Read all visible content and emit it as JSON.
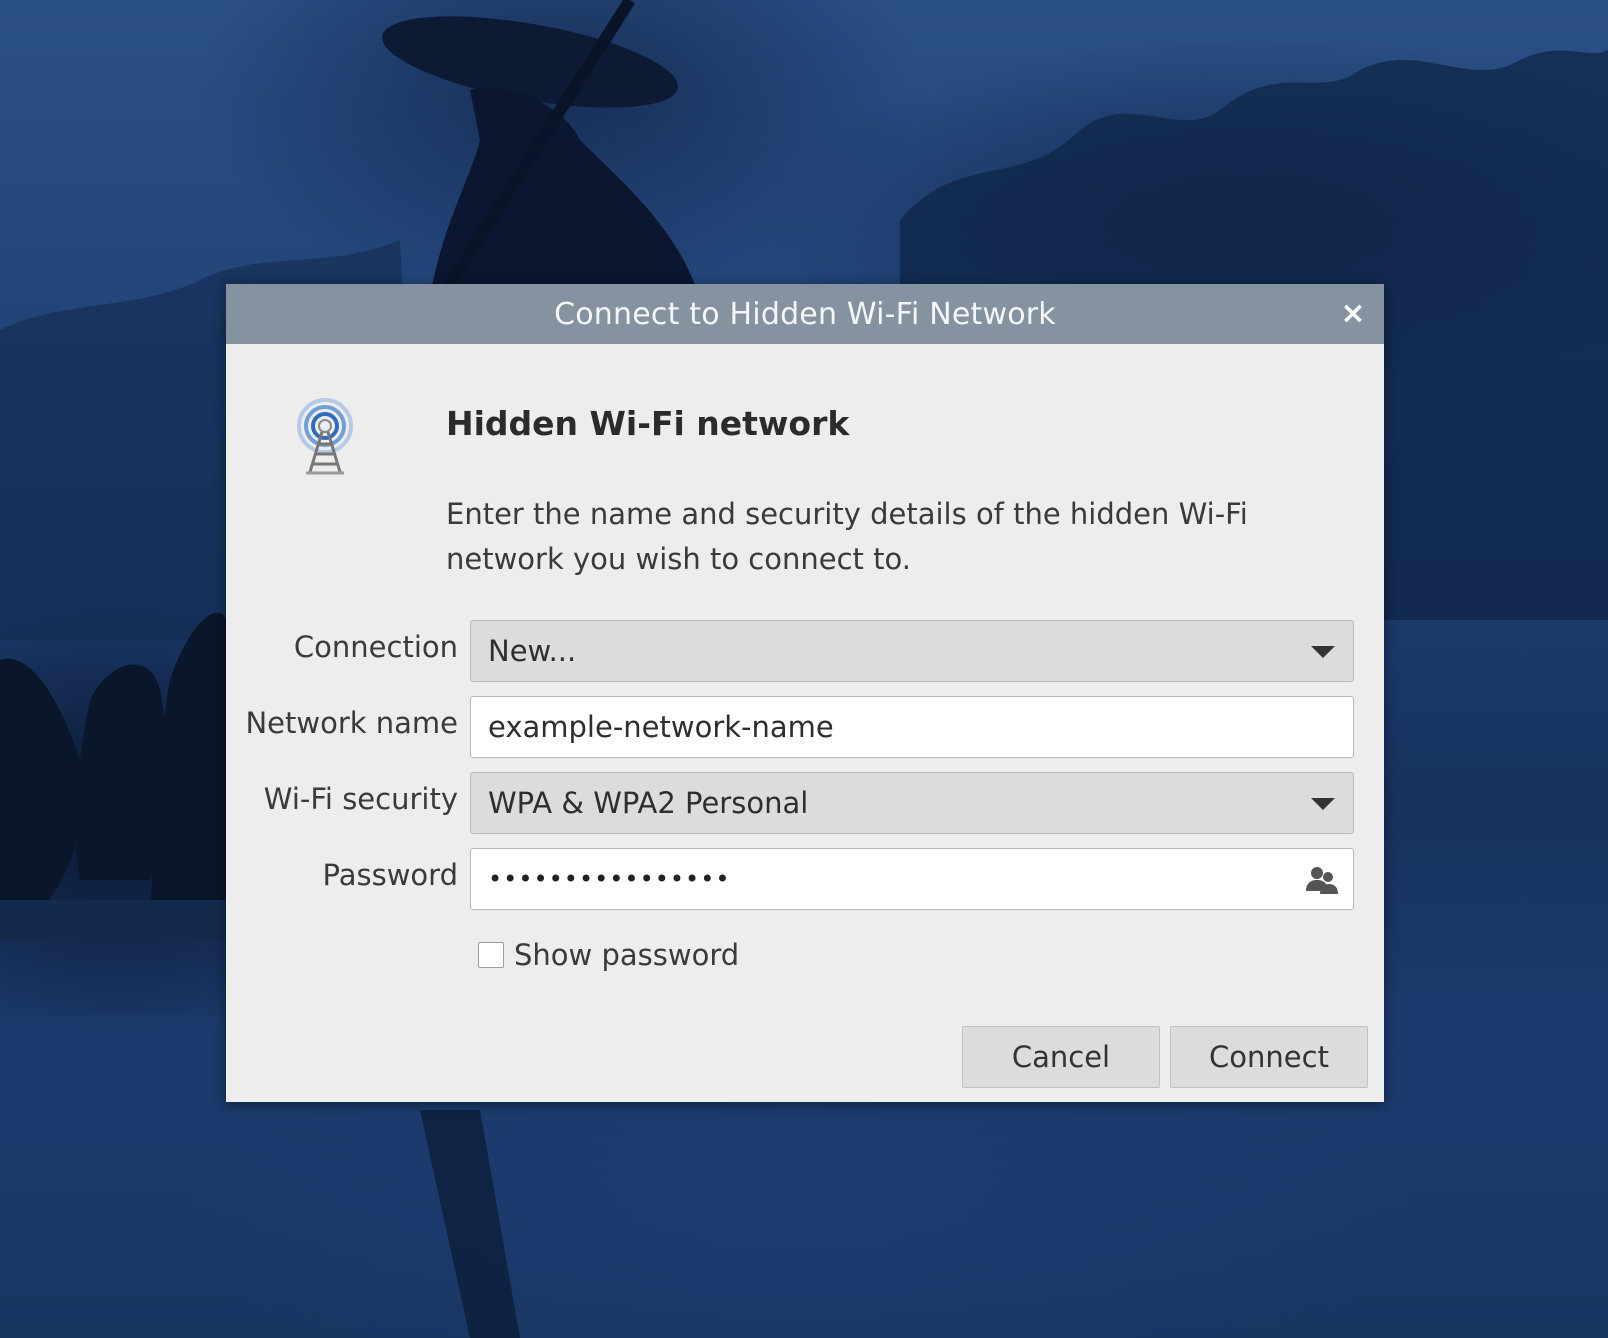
{
  "dialog": {
    "title": "Connect to Hidden Wi-Fi Network",
    "close_symbol": "×",
    "icon": "wifi-antenna-icon",
    "heading": "Hidden Wi-Fi network",
    "description": "Enter the name and security details of the hidden Wi-Fi network you wish to connect to.",
    "form": {
      "connection": {
        "label": "Connection",
        "value": "New..."
      },
      "network_name": {
        "label": "Network name",
        "value": "example-network-name"
      },
      "wifi_security": {
        "label": "Wi-Fi security",
        "value": "WPA & WPA2 Personal"
      },
      "password": {
        "label": "Password",
        "value": "••••••••••••••••",
        "icon": "user-options-icon"
      },
      "show_password": {
        "label": "Show password",
        "checked": false
      }
    },
    "buttons": {
      "cancel": "Cancel",
      "connect": "Connect"
    }
  },
  "colors": {
    "titlebar": "#8592a0",
    "dialog_bg": "#ededed",
    "combo_bg": "#dcdcdc",
    "wallpaper": "#1f3f73"
  }
}
